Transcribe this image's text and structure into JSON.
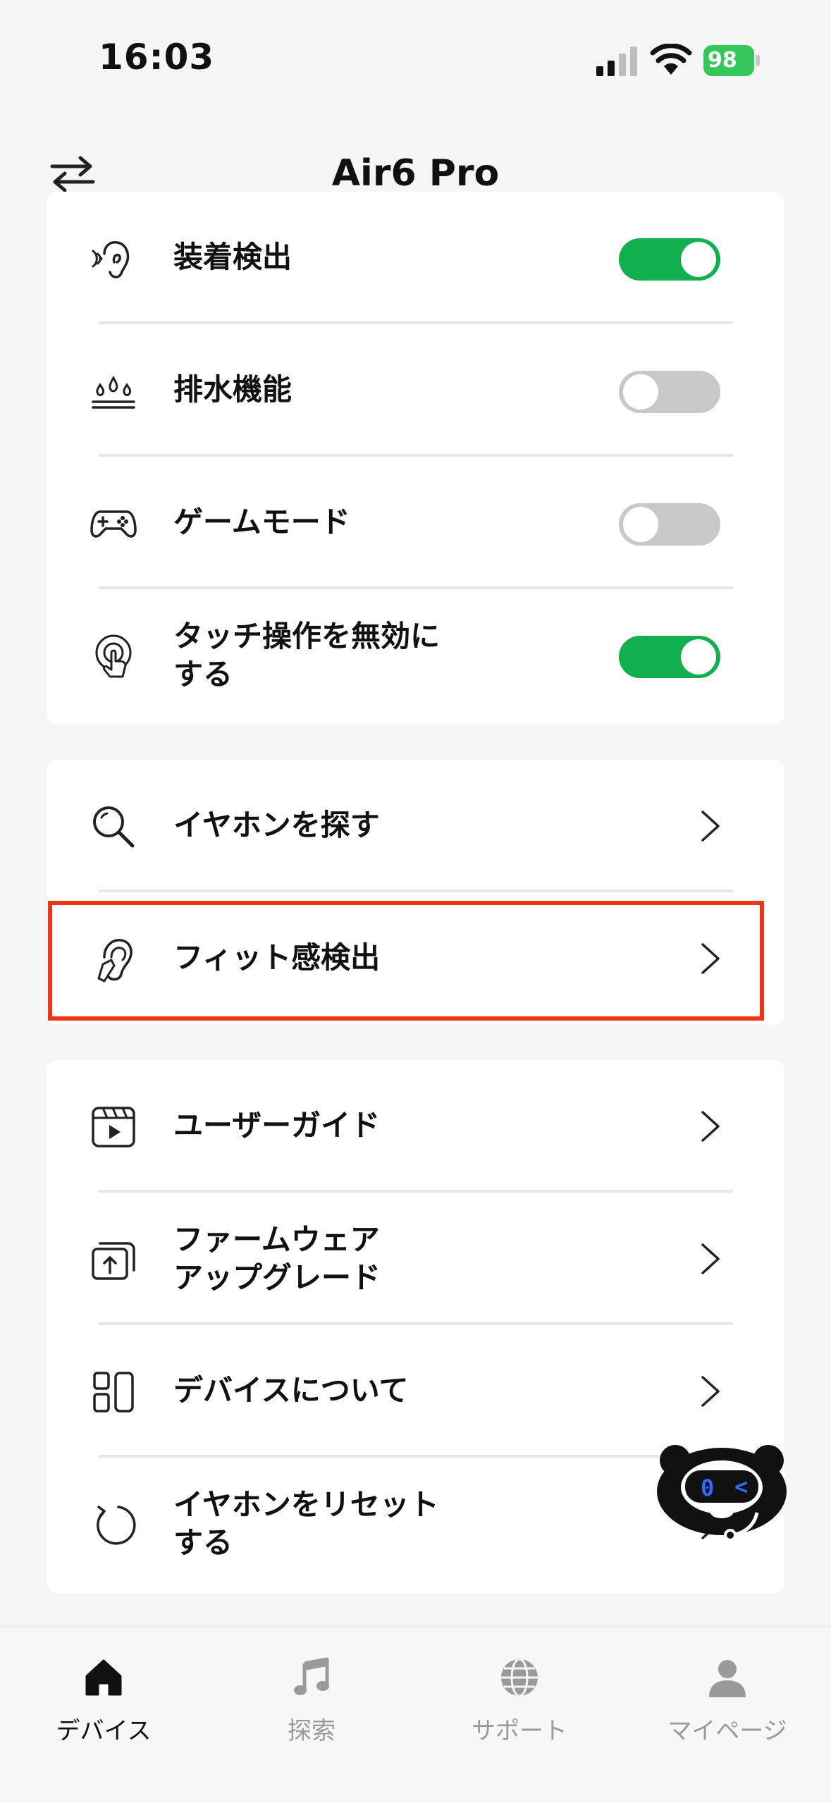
{
  "status_bar": {
    "time": "16:03",
    "battery": "98"
  },
  "header": {
    "title": "Air6 Pro"
  },
  "settings_card": {
    "items": [
      {
        "label": "装着検出",
        "toggle_on": true
      },
      {
        "label": "排水機能",
        "toggle_on": false
      },
      {
        "label": "ゲームモード",
        "toggle_on": false
      },
      {
        "label_line1": "タッチ操作を無効に",
        "label_line2": "する",
        "toggle_on": true
      }
    ]
  },
  "tools_card": {
    "items": [
      {
        "label": "イヤホンを探す"
      },
      {
        "label": "フィット感検出"
      }
    ]
  },
  "info_card": {
    "items": [
      {
        "label": "ユーザーガイド"
      },
      {
        "label_line1": "ファームウェア",
        "label_line2": "アップグレード"
      },
      {
        "label": "デバイスについて"
      },
      {
        "label_line1": "イヤホンをリセット",
        "label_line2": "する"
      }
    ]
  },
  "tabbar": {
    "tabs": [
      {
        "label": "デバイス",
        "icon": "home-icon",
        "active": true
      },
      {
        "label": "探索",
        "icon": "music-note-icon",
        "active": false
      },
      {
        "label": "サポート",
        "icon": "globe-icon",
        "active": false
      },
      {
        "label": "マイページ",
        "icon": "person-icon",
        "active": false
      }
    ]
  },
  "colors": {
    "toggle_on": "#10b04f",
    "toggle_off": "#c8c8cb",
    "highlight": "#ee3517",
    "battery": "#34c759"
  }
}
